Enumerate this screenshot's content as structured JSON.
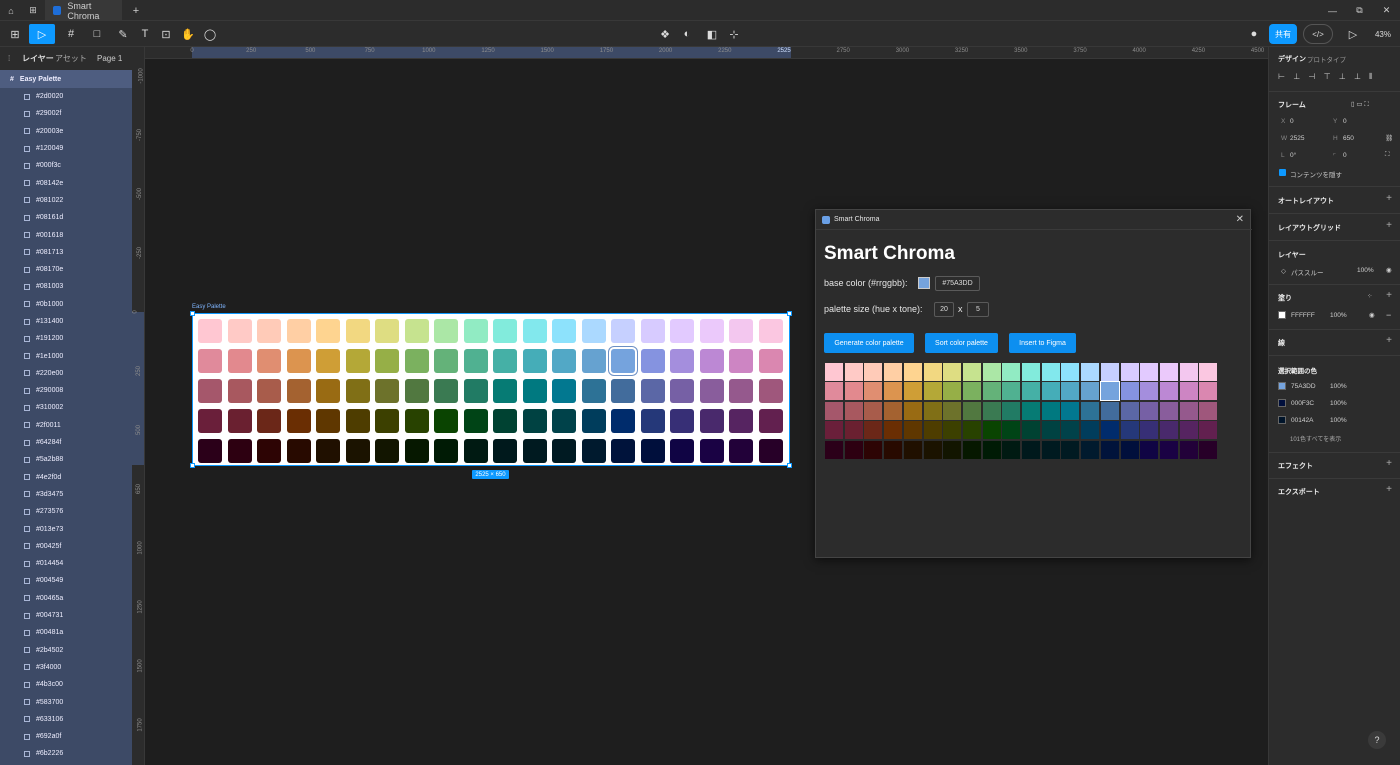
{
  "tabs": {
    "active": "Smart Chroma",
    "home_icon": "home-icon",
    "grid_icon": "grid-icon",
    "plus": "+"
  },
  "window": {
    "min": "—",
    "restore": "⧉",
    "close": "✕"
  },
  "toolbar": {
    "zoom": "43%",
    "share": "共有",
    "dev_mode": "</>"
  },
  "left_panel": {
    "tab_layers": "レイヤー",
    "tab_assets": "アセット",
    "page": "Page 1",
    "frame_name": "Easy Palette",
    "layers": [
      "#2d0020",
      "#29002f",
      "#20003e",
      "#120049",
      "#000f3c",
      "#08142e",
      "#081022",
      "#08161d",
      "#001618",
      "#081713",
      "#08170e",
      "#081003",
      "#0b1000",
      "#131400",
      "#191200",
      "#1e1000",
      "#220e00",
      "#290008",
      "#310002",
      "#2f0011",
      "#64284f",
      "#5a2b88",
      "#4e2f0d",
      "#3d3475",
      "#273576",
      "#013e73",
      "#00425f",
      "#014454",
      "#004549",
      "#00465a",
      "#004731",
      "#00481a",
      "#2b4502",
      "#3f4000",
      "#4b3c00",
      "#583700",
      "#633106",
      "#692a0f",
      "#6b2226"
    ]
  },
  "rulers": {
    "top": [
      "0",
      "250",
      "500",
      "750",
      "1000",
      "1250",
      "1500",
      "1750",
      "2000",
      "2250",
      "2525",
      "2750",
      "3000",
      "3250",
      "3500",
      "3750",
      "4000",
      "4250",
      "4500"
    ],
    "left": [
      "-1000",
      "-750",
      "-500",
      "-250",
      "0",
      "250",
      "500",
      "650",
      "1000",
      "1250",
      "1500",
      "1750"
    ]
  },
  "canvas": {
    "frame_label": "Easy Palette",
    "size_badge": "2525 × 650"
  },
  "palette": {
    "rows": [
      [
        "#ffc7d2",
        "#ffcac6",
        "#ffcbb8",
        "#ffcfa4",
        "#fed490",
        "#f2d881",
        "#dedd82",
        "#c6e38f",
        "#abe7a6",
        "#91ebc3",
        "#82ebdc",
        "#82e8ed",
        "#8de2fc",
        "#abd9ff",
        "#c6d0ff",
        "#d7cbff",
        "#e2caff",
        "#ebc9fb",
        "#f3c7ef",
        "#fbc7e1"
      ],
      [
        "#e08a9b",
        "#e2898e",
        "#e08e71",
        "#dc944f",
        "#cf9e36",
        "#b4a837",
        "#96af47",
        "#7bb15f",
        "#64b279",
        "#50b191",
        "#45b0a6",
        "#45adb8",
        "#52a8c6",
        "#66a2d0",
        "#75a3dd",
        "#8593e0",
        "#a48edd",
        "#bc88d4",
        "#cd85c3",
        "#da87b0"
      ],
      [
        "#a5576b",
        "#a8585f",
        "#a85c4b",
        "#a46230",
        "#996b13",
        "#806f16",
        "#6d722b",
        "#517840",
        "#3a7a52",
        "#217b64",
        "#067b74",
        "#007980",
        "#027890",
        "#2d7296",
        "#426c9c",
        "#5b67a6",
        "#7660a5",
        "#895d9c",
        "#95598d",
        "#9f577c"
      ],
      [
        "#6a1f3a",
        "#6a2030",
        "#6b2718",
        "#6a2e03",
        "#5f3700",
        "#4e3d00",
        "#3c4000",
        "#284200",
        "#0a4401",
        "#004416",
        "#004232",
        "#004242",
        "#00424a",
        "#003d5c",
        "#002c6c",
        "#253879",
        "#372f76",
        "#49296c",
        "#562461",
        "#62204f"
      ],
      [
        "#2b0019",
        "#2d0011",
        "#2d0404",
        "#280a00",
        "#201000",
        "#1b1300",
        "#121500",
        "#061800",
        "#001b05",
        "#001a12",
        "#00191c",
        "#001a20",
        "#001a22",
        "#001a2e",
        "#00133b",
        "#000f3c",
        "#100444",
        "#1a0244",
        "#220139",
        "#270028"
      ]
    ],
    "selected": "#75a3dd"
  },
  "plugin": {
    "window_title": "Smart Chroma",
    "title": "Smart Chroma",
    "base_color_label": "base color (#rrggbb):",
    "base_color_value": "#75A3DD",
    "size_label": "palette size (hue x tone):",
    "hue": "20",
    "x": "x",
    "tone": "5",
    "btn_generate": "Generate color palette",
    "btn_sort": "Sort color palette",
    "btn_insert": "Insert to Figma",
    "close": "✕"
  },
  "right_panel": {
    "tab_design": "デザイン",
    "tab_proto": "プロトタイプ",
    "frame_label": "フレーム",
    "x_label": "X",
    "x": "0",
    "y_label": "Y",
    "y": "0",
    "w_label": "W",
    "w": "2525",
    "h_label": "H",
    "h": "650",
    "rot_label": "L",
    "rot": "0°",
    "rad_label": "⌜",
    "rad": "0",
    "clip": "コンテンツを隠す",
    "auto_layout": "オートレイアウト",
    "layout_grid": "レイアウトグリッド",
    "layer": "レイヤー",
    "blend": "パススルー",
    "layer_opacity": "100%",
    "fill": "塗り",
    "fill_hex": "FFFFFF",
    "fill_opacity": "100%",
    "stroke": "線",
    "selection_colors": "選択範囲の色",
    "sel_colors": [
      {
        "color": "#75A3DD",
        "hex": "75A3DD",
        "op": "100%"
      },
      {
        "color": "#000F3C",
        "hex": "000F3C",
        "op": "100%"
      },
      {
        "color": "#00142A",
        "hex": "00142A",
        "op": "100%"
      }
    ],
    "see_all": "101色すべてを表示",
    "effects": "エフェクト",
    "export": "エクスポート"
  },
  "help": "?"
}
